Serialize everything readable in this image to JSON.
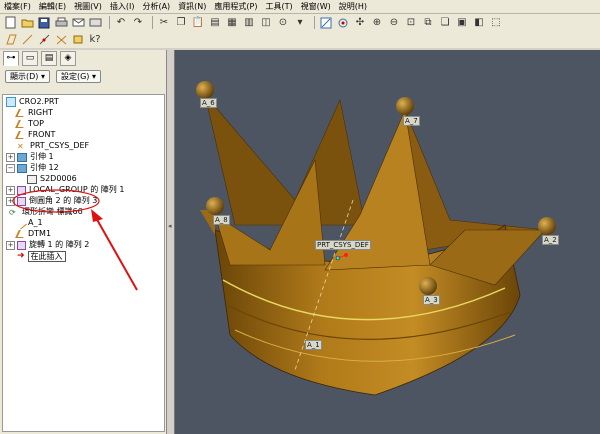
{
  "menu": [
    "檔案(F)",
    "編輯(E)",
    "視圖(V)",
    "插入(I)",
    "分析(A)",
    "資訊(N)",
    "應用程式(P)",
    "工具(T)",
    "視窗(W)",
    "說明(H)"
  ],
  "panel": {
    "display_label": "顯示(D) ▾",
    "settings_label": "設定(G) ▾"
  },
  "tree": {
    "root": "CRO2.PRT",
    "items": [
      "RIGHT",
      "TOP",
      "FRONT",
      "PRT_CSYS_DEF",
      "引伸 1",
      "引伸 12",
      "S2D0006",
      "LOCAL_GROUP 的 陣列 1",
      "倒圓角 2 的 陣列 3",
      "環形折彎 標識66",
      "A_1",
      "DTM1",
      "旋轉 1 的 陣列 2",
      "在此插入"
    ]
  },
  "viewport": {
    "csys_label": "PRT_CSYS_DEF",
    "axis_label": "A_1",
    "point_labels": [
      "A_6",
      "A_7",
      "A_8",
      "A_2",
      "A_3"
    ],
    "colors": {
      "background": "#4d5563",
      "model": "#a06c14",
      "highlight": "#e8d860",
      "annotation_circle": "#e01010",
      "annotation_arrow": "#e01010"
    }
  }
}
